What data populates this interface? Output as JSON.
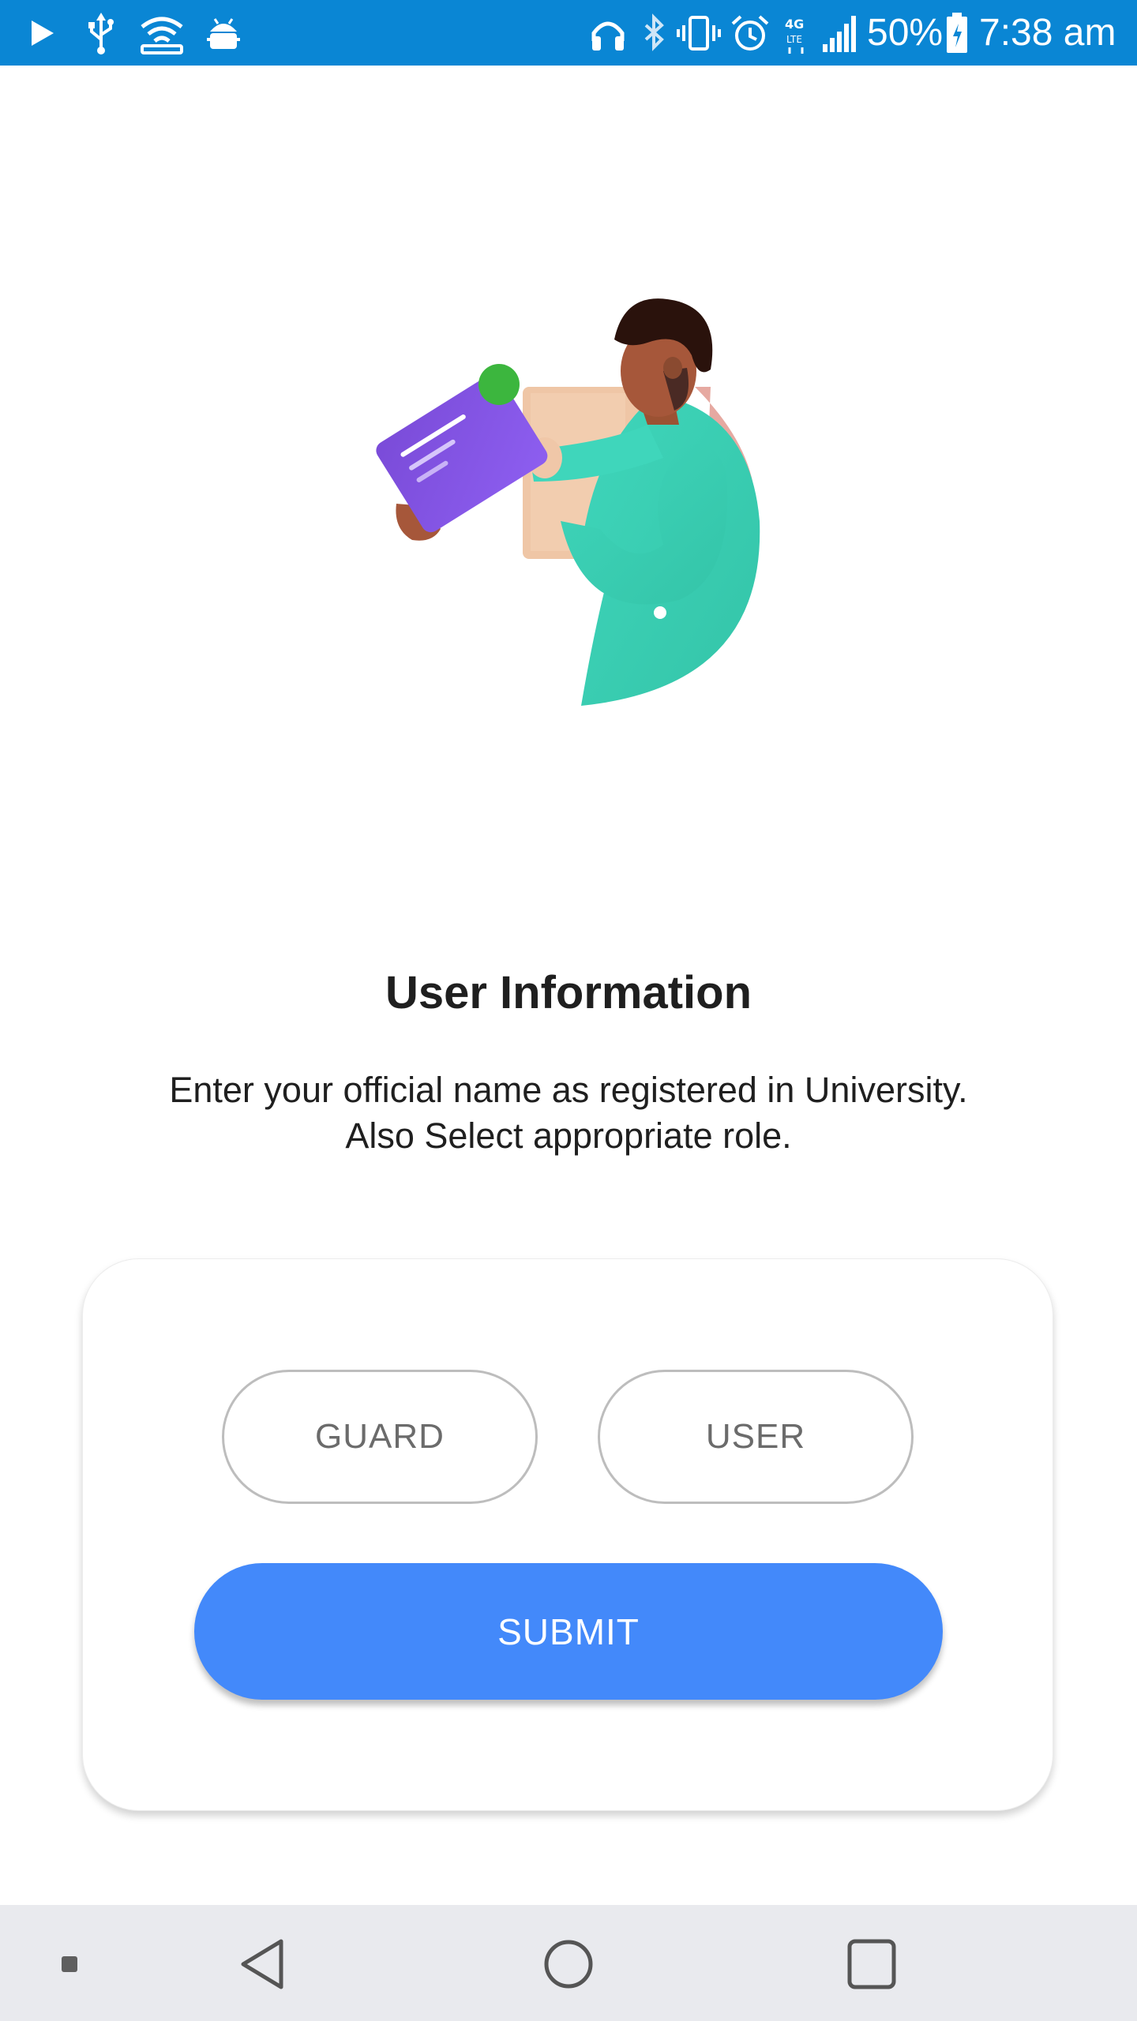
{
  "status_bar": {
    "battery_percent": "50%",
    "time": "7:38 am",
    "background_color": "#0a86d4",
    "left_icons": [
      "play-icon",
      "usb-icon",
      "wifi-hotspot-icon",
      "android-debug-icon"
    ],
    "right_icons": [
      "headphones-icon",
      "bluetooth-icon",
      "vibrate-icon",
      "alarm-icon",
      "4g-lte-icon",
      "signal-icon",
      "battery-icon"
    ]
  },
  "page": {
    "title": "User Information",
    "subtitle_line1": "Enter your official name as registered in University.",
    "subtitle_line2": "Also Select appropriate role."
  },
  "roles": {
    "guard_label": "GUARD",
    "user_label": "USER"
  },
  "submit": {
    "label": "SUBMIT",
    "color": "#4389fa"
  },
  "nav_bar": {
    "items": [
      "recent-dot-icon",
      "back-icon",
      "home-icon",
      "overview-icon"
    ]
  }
}
